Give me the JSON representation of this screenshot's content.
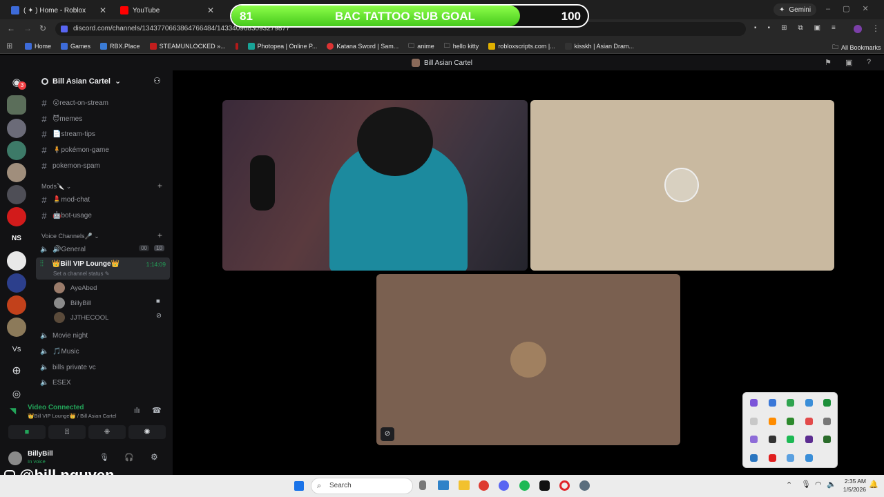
{
  "browser": {
    "tabs": [
      {
        "title": "( ✦ ) Home - Roblox",
        "color": "#3d6bd9"
      },
      {
        "title": "YouTube",
        "color": "#ff0000"
      }
    ],
    "gemini_label": "Gemini",
    "url": "discord.com/channels/1343770663864766484/1433409683093279877",
    "bookmarks": [
      "Home",
      "Games",
      "RBX.Place",
      "STEAMUNLOCKED »...",
      "Photopea | Online P...",
      "Katana Sword | Sam...",
      "anime",
      "hello kitty",
      "robloxscripts.com |...",
      "kisskh | Asian Dram..."
    ],
    "all_bookmarks": "All Bookmarks"
  },
  "goal": {
    "current": "81",
    "label": "BAC TATTOO SUB GOAL",
    "target": "100",
    "progress": 0.81
  },
  "discord": {
    "server_name": "Bill Asian Cartel",
    "topbar_title": "Bill Asian Cartel",
    "guild_badge": "3",
    "guild_ns": "NS",
    "guild_vs": "Vs",
    "channels": [
      {
        "name": "😮react-on-stream"
      },
      {
        "name": "😈memes"
      },
      {
        "name": "📄stream-tips"
      },
      {
        "name": "🧍pokémon-game"
      },
      {
        "name": "pokemon-spam"
      }
    ],
    "mods_category": "Mods🔪",
    "mod_channels": [
      {
        "name": "💄mod-chat"
      },
      {
        "name": "🤖bot-usage"
      }
    ],
    "voice_category": "Voice Channels🎤",
    "voice_general": "🔊General",
    "general_count_a": "00",
    "general_count_b": "10",
    "vip_lounge": "👑Bill VIP Lounge👑",
    "vip_timer": "1:14:09",
    "vip_status": "Set a channel status",
    "users": [
      "AyeAbed",
      "BillyBill",
      "JJTHECOOL"
    ],
    "more_voice": [
      "Movie night",
      "🎵Music",
      "bills private vc",
      "ESEX"
    ],
    "voice_connected": "Video Connected",
    "voice_location": "👑Bill VIP Lounge👑 / Bill Asian Cartel",
    "self_name": "BillyBill",
    "self_status": "In voice"
  },
  "watermark": "@bill.nguyen",
  "taskbar": {
    "search": "Search",
    "time": "2:35 AM",
    "date": "1/5/2026"
  }
}
